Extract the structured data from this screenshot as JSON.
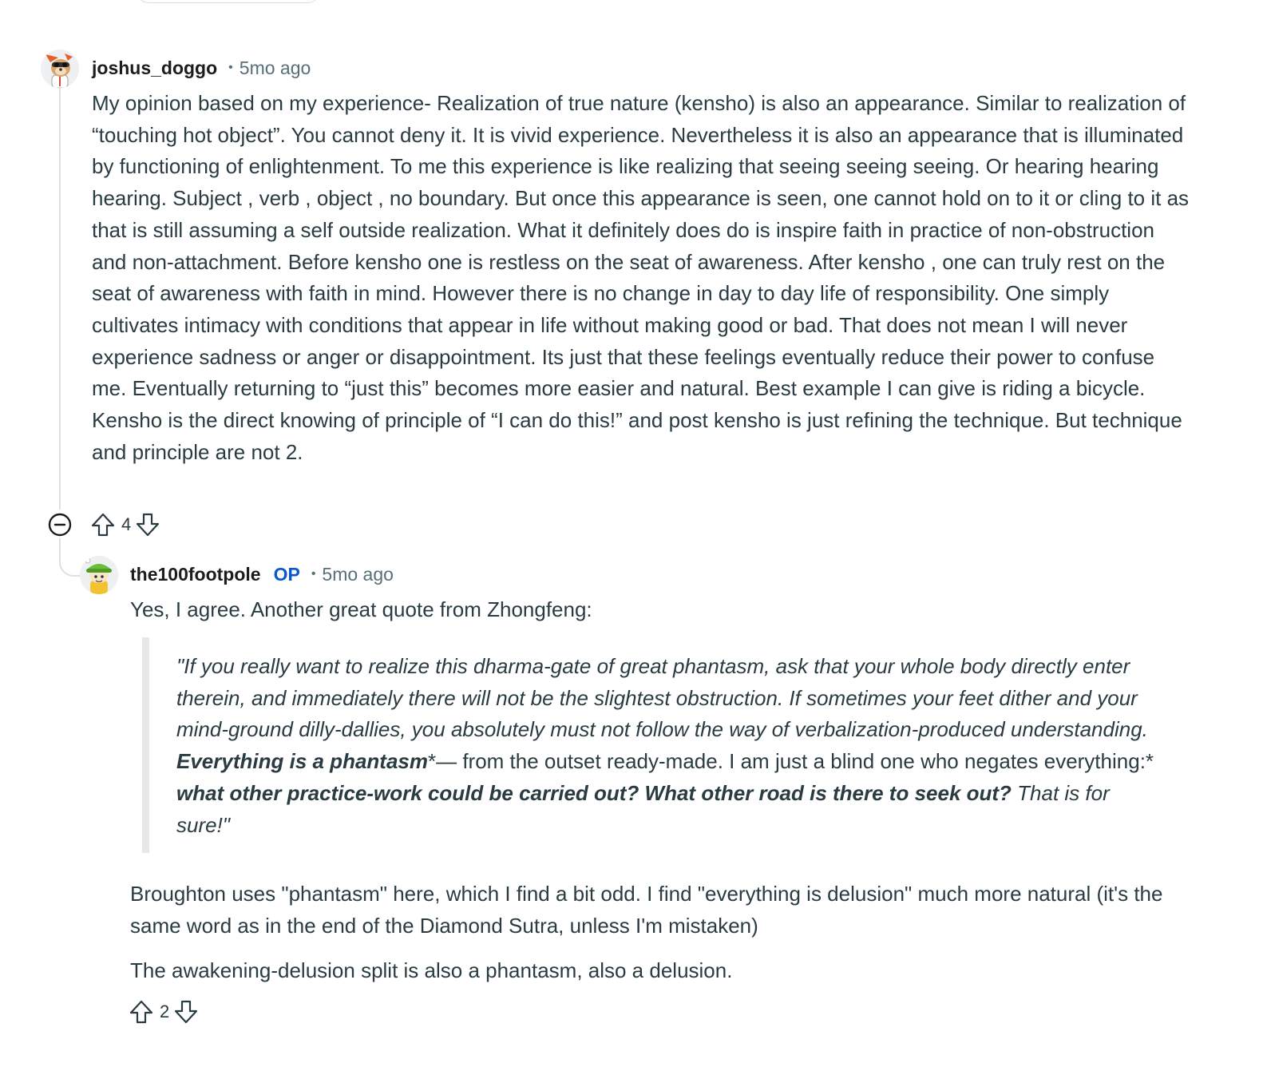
{
  "comments": [
    {
      "username": "joshus_doggo",
      "separator": "•",
      "time": "5mo ago",
      "avatar_icon": "dog-snoo-avatar-icon",
      "body": "My opinion based on my experience- Realization of true nature (kensho) is also an appearance. Similar to realization of “touching hot object”. You cannot deny it. It is vivid experience. Nevertheless it is also an appearance that is illuminated by functioning of enlightenment. To me this experience is like realizing that seeing seeing seeing. Or hearing hearing hearing. Subject , verb , object , no boundary. But once this appearance is seen, one cannot hold on to it or cling to it as that is still assuming a self outside realization. What it definitely does do is inspire faith in practice of non-obstruction and non-attachment. Before kensho one is restless on the seat of awareness. After kensho , one can truly rest on the seat of awareness with faith in mind. However there is no change in day to day life of responsibility. One simply cultivates intimacy with conditions that appear in life without making good or bad. That does not mean I will never experience sadness or anger or disappointment. Its just that these feelings eventually reduce their power to confuse me. Eventually returning to “just this” becomes more easier and natural. Best example I can give is riding a bicycle. Kensho is the direct knowing of principle of “I can do this!” and post kensho is just refining the technique. But technique and principle are not 2.",
      "votes": "4",
      "upvote_icon": "upvote-arrow-icon",
      "downvote_icon": "downvote-arrow-icon",
      "collapse_icon": "collapse-minus-icon"
    },
    {
      "username": "the100footpole",
      "op_badge": "OP",
      "separator": "•",
      "time": "5mo ago",
      "avatar_icon": "green-hat-snoo-avatar-icon",
      "intro": "Yes, I agree. Another great quote from Zhongfeng:",
      "quote": {
        "part1": "\"If you really want to realize this dharma-gate of great phantasm, ask that your whole body directly enter therein, and immediately there will not be the slightest obstruction. If sometimes your feet dither and your mind-ground dilly-dallies, you absolutely must not follow the way of verbalization-produced understanding. ",
        "bold1": "Everything is a phantasm",
        "part2": "*— from the outset ready-made. I am just a blind one who negates everything:* ",
        "bold2": "what other practice-work could be carried out? What other road is there to seek out?",
        "part3": " That is for sure!\""
      },
      "para1": "Broughton uses \"phantasm\" here, which I find a bit odd. I find \"everything is delusion\" much more natural (it's the same word as in the end of the Diamond Sutra, unless I'm mistaken)",
      "para2": "The awakening-delusion split is also a phantasm, also a delusion.",
      "votes": "2",
      "upvote_icon": "upvote-arrow-icon",
      "downvote_icon": "downvote-arrow-icon"
    }
  ]
}
